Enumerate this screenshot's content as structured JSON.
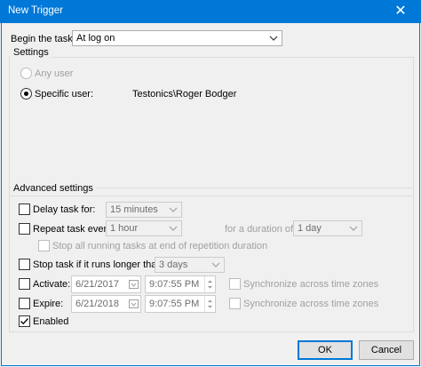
{
  "window": {
    "title": "New Trigger",
    "close_glyph": "✕"
  },
  "begin_task": {
    "label": "Begin the task:",
    "value": "At log on"
  },
  "settings": {
    "title": "Settings",
    "any_user_label": "Any user",
    "specific_user_label": "Specific user:",
    "specific_user_selected": true,
    "user_value": "Testonics\\Roger Bodger"
  },
  "advanced": {
    "title": "Advanced settings",
    "delay_task": {
      "label": "Delay task for:",
      "checked": false,
      "value": "15 minutes"
    },
    "repeat_task": {
      "label": "Repeat task every:",
      "checked": false,
      "value": "1 hour",
      "duration_label": "for a duration of:",
      "duration_value": "1 day",
      "stop_all_label": "Stop all running tasks at end of repetition duration"
    },
    "stop_task": {
      "label": "Stop task if it runs longer than:",
      "checked": false,
      "value": "3 days"
    },
    "activate": {
      "label": "Activate:",
      "checked": false,
      "date": "6/21/2017",
      "time": "9:07:55 PM",
      "sync_label": "Synchronize across time zones"
    },
    "expire": {
      "label": "Expire:",
      "checked": false,
      "date": "6/21/2018",
      "time": "9:07:55 PM",
      "sync_label": "Synchronize across time zones"
    },
    "enabled": {
      "label": "Enabled",
      "checked": true
    }
  },
  "buttons": {
    "ok": "OK",
    "cancel": "Cancel"
  },
  "colors": {
    "titlebar": "#0078d7",
    "dialog_bg": "#f0f0f0",
    "disabled_text": "#a0a0a0"
  }
}
